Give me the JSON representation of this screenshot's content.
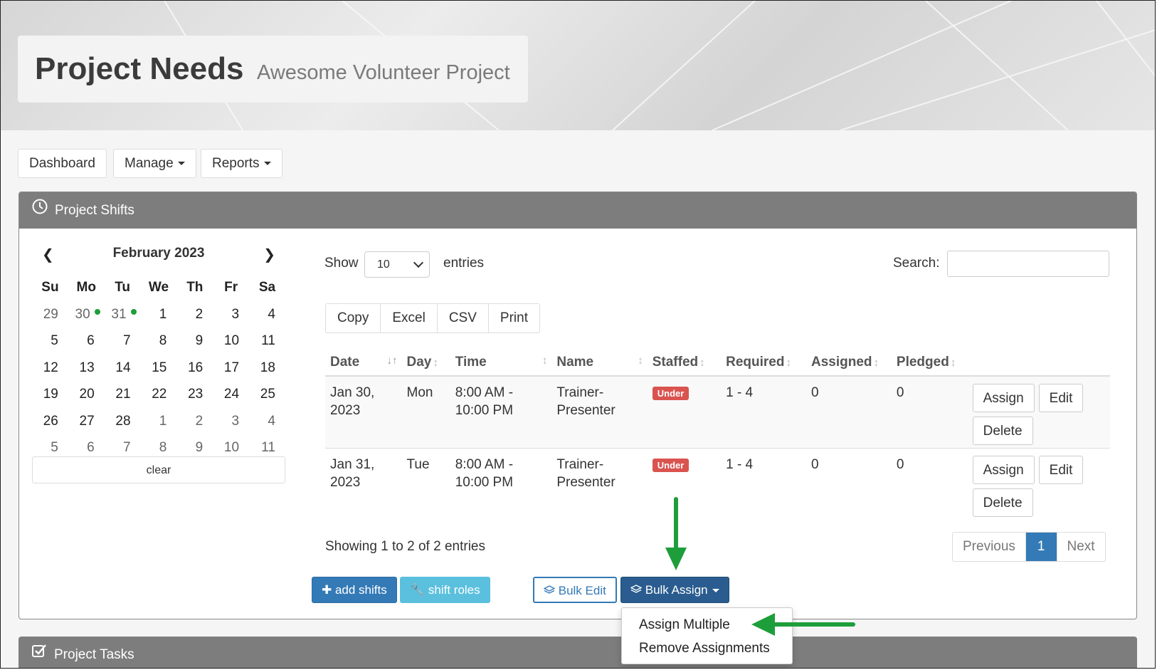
{
  "header": {
    "title": "Project Needs",
    "subtitle": "Awesome Volunteer Project"
  },
  "nav": {
    "dashboard": "Dashboard",
    "manage": "Manage",
    "reports": "Reports"
  },
  "shifts_panel": {
    "title": "Project Shifts"
  },
  "tasks_panel": {
    "title": "Project Tasks"
  },
  "calendar": {
    "month": "February 2023",
    "weekdays": [
      "Su",
      "Mo",
      "Tu",
      "We",
      "Th",
      "Fr",
      "Sa"
    ],
    "weeks": [
      [
        "29",
        "30",
        "31",
        "1",
        "2",
        "3",
        "4"
      ],
      [
        "5",
        "6",
        "7",
        "8",
        "9",
        "10",
        "11"
      ],
      [
        "12",
        "13",
        "14",
        "15",
        "16",
        "17",
        "18"
      ],
      [
        "19",
        "20",
        "21",
        "22",
        "23",
        "24",
        "25"
      ],
      [
        "26",
        "27",
        "28",
        "1",
        "2",
        "3",
        "4"
      ],
      [
        "5",
        "6",
        "7",
        "8",
        "9",
        "10",
        "11"
      ]
    ],
    "clear": "clear"
  },
  "controls": {
    "show_label": "Show",
    "entries_selected": "10",
    "entries_label": "entries",
    "search_label": "Search:",
    "search_value": "",
    "export_buttons": [
      "Copy",
      "Excel",
      "CSV",
      "Print"
    ]
  },
  "table": {
    "columns": [
      "Date",
      "Day",
      "Time",
      "Name",
      "Staffed",
      "Required",
      "Assigned",
      "Pledged"
    ],
    "rows": [
      {
        "date1": "Jan 30,",
        "date2": "2023",
        "day": "Mon",
        "time1": "8:00 AM -",
        "time2": "10:00 PM",
        "name1": "Trainer-",
        "name2": "Presenter",
        "staffed": "Under",
        "required": "1 - 4",
        "assigned": "0",
        "pledged": "0"
      },
      {
        "date1": "Jan 31,",
        "date2": "2023",
        "day": "Tue",
        "time1": "8:00 AM -",
        "time2": "10:00 PM",
        "name1": "Trainer-",
        "name2": "Presenter",
        "staffed": "Under",
        "required": "1 - 4",
        "assigned": "0",
        "pledged": "0"
      }
    ],
    "actions": {
      "assign": "Assign",
      "edit": "Edit",
      "delete": "Delete"
    }
  },
  "footer": {
    "showing": "Showing 1 to 2 of 2 entries",
    "pager": {
      "previous": "Previous",
      "current": "1",
      "next": "Next"
    }
  },
  "buttons": {
    "add_shifts": "add shifts",
    "shift_roles": "shift roles",
    "bulk_edit": "Bulk Edit",
    "bulk_assign": "Bulk Assign"
  },
  "bulk_assign_menu": [
    "Assign Multiple",
    "Remove Assignments"
  ],
  "colors": {
    "primary": "#337ab7",
    "info": "#5bc0de",
    "danger": "#d9534f",
    "annotation_arrow": "#1e9e3a"
  }
}
